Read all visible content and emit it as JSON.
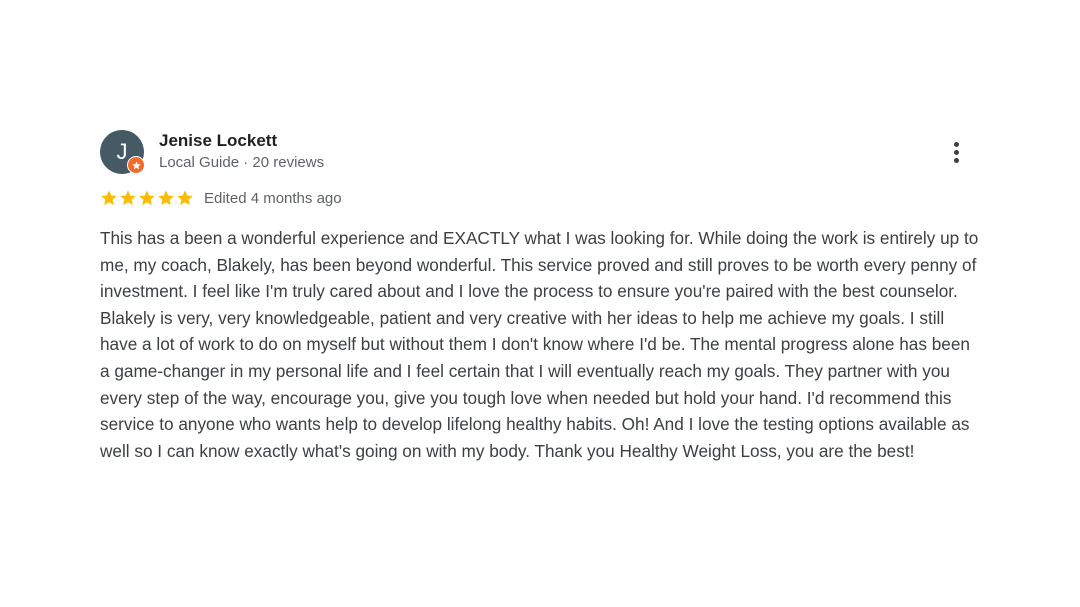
{
  "reviewer": {
    "initial": "J",
    "name": "Jenise Lockett",
    "meta": "Local Guide · 20 reviews",
    "avatar_color": "#455a64",
    "badge_color": "#f36a2b",
    "badge_icon": "local-guide-star-icon"
  },
  "rating": {
    "stars": 5,
    "max_stars": 5,
    "star_color": "#fbbc04",
    "edited_label": "Edited 4 months ago"
  },
  "menu": {
    "icon": "more-vertical-icon"
  },
  "review": {
    "text": "This has a been a wonderful experience and EXACTLY what I was looking for. While doing the work is entirely up to me, my coach, Blakely, has been beyond wonderful. This service proved and still proves to be worth every penny of investment. I feel like I'm truly cared about and I love the process to ensure you're paired with the best counselor. Blakely is very, very knowledgeable, patient and very creative with her ideas to help me achieve my goals. I still have a lot of work to do on myself but without them I don't know where I'd be. The mental progress alone has been a game-changer in my personal life and I feel certain that I will eventually reach my goals. They partner with you every step of the way, encourage you, give you tough love when needed but hold your hand. I'd recommend this service to anyone who wants help to develop lifelong healthy habits. Oh! And I love the testing options available as well so I can know exactly what's going on with my body. Thank you Healthy Weight Loss, you are the best!"
  }
}
